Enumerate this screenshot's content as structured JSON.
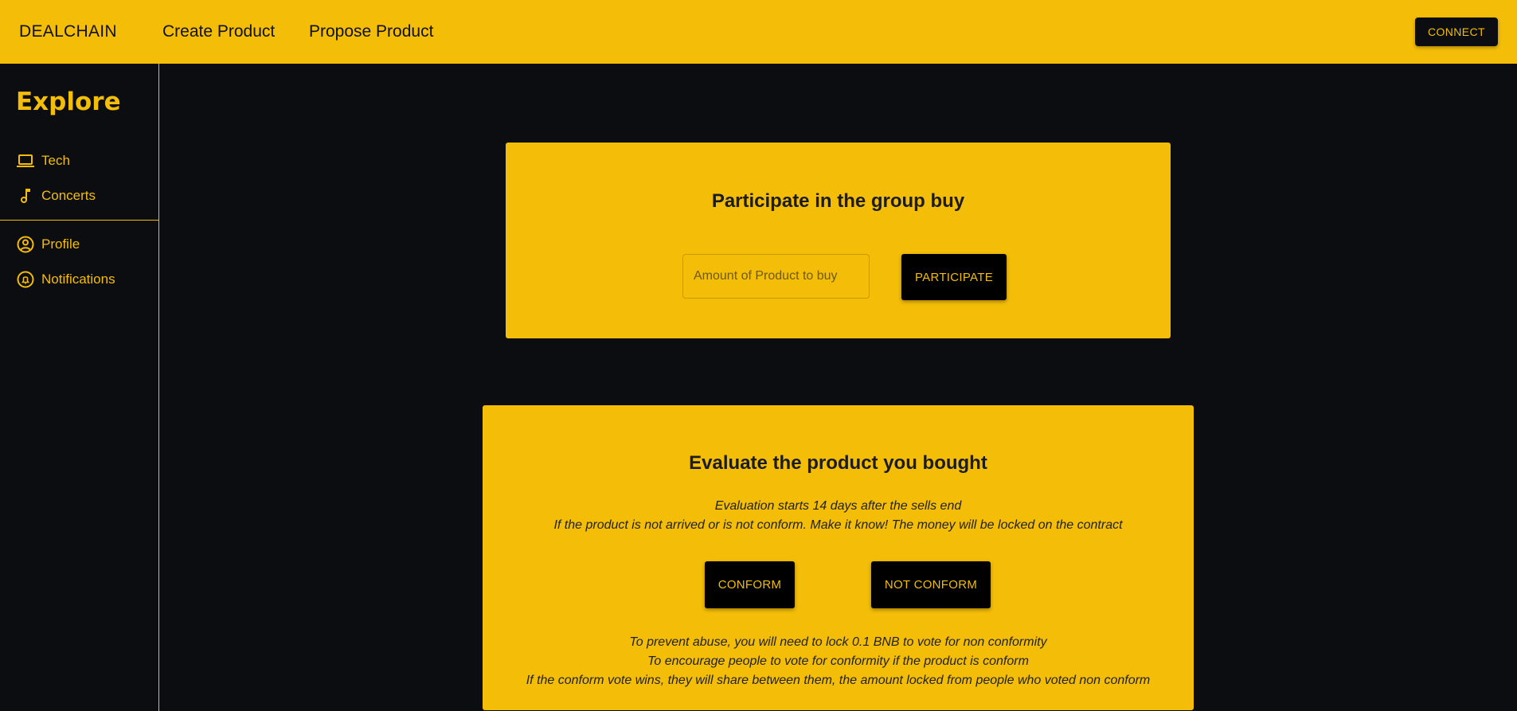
{
  "header": {
    "brand": "DEALCHAIN",
    "nav": [
      "Create Product",
      "Propose Product"
    ],
    "connect_label": "CONNECT"
  },
  "sidebar": {
    "title": "Explore",
    "categories": [
      {
        "label": "Tech",
        "icon": "laptop-icon"
      },
      {
        "label": "Concerts",
        "icon": "music-note-icon"
      }
    ],
    "account": [
      {
        "label": "Profile",
        "icon": "account-circle-icon"
      },
      {
        "label": "Notifications",
        "icon": "bell-icon"
      }
    ]
  },
  "participate_card": {
    "title": "Participate in the group buy",
    "input_placeholder": "Amount of Product to buy",
    "button_label": "PARTICIPATE"
  },
  "evaluate_card": {
    "title": "Evaluate the product you bought",
    "info": [
      "Evaluation starts 14 days after the sells end",
      "If the product is not arrived or is not conform. Make it know! The money will be locked on the contract"
    ],
    "conform_label": "CONFORM",
    "not_conform_label": "NOT CONFORM",
    "rules": [
      "To prevent abuse, you will need to lock 0.1 BNB to vote for non conformity",
      "To encourage people to vote for conformity if the product is conform",
      "If the conform vote wins, they will share between them, the amount locked from people who voted non conform"
    ]
  },
  "colors": {
    "accent": "#f3bd08",
    "background": "#0c0d10",
    "button": "#000000"
  }
}
